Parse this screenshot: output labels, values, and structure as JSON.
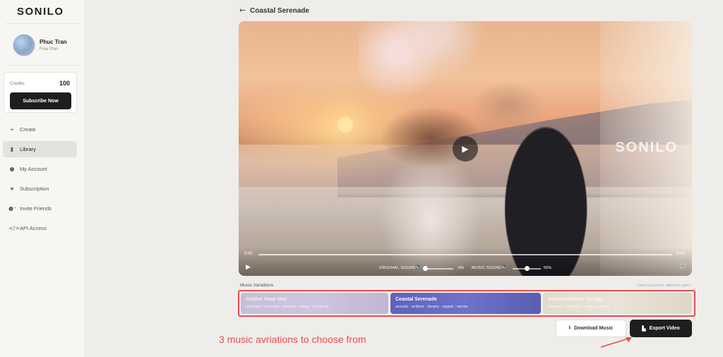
{
  "brand": {
    "logo": "SONILO"
  },
  "profile": {
    "name": "Phuc Tran",
    "plan": "Free Plan"
  },
  "credits": {
    "label": "Credits",
    "value": "100",
    "subscribe_label": "Subscribe Now"
  },
  "nav": [
    {
      "label": "Create",
      "icon": "plus-icon",
      "active": false
    },
    {
      "label": "Library",
      "icon": "book-icon",
      "active": true
    },
    {
      "label": "My Account",
      "icon": "user-icon",
      "active": false
    },
    {
      "label": "Subscription",
      "icon": "star-icon",
      "active": false
    },
    {
      "label": "Invite Friends",
      "icon": "user-plus-icon",
      "active": false
    },
    {
      "label": "API Access",
      "icon": "code-icon",
      "active": false
    }
  ],
  "page": {
    "title": "Coastal Serenade"
  },
  "video": {
    "watermark": "SONILO",
    "current_time": "0:00",
    "duration": "0:00",
    "progress": 0,
    "original_sound_label": "ORIGINAL SOUND",
    "original_sound_pct": "0%",
    "original_sound_level": 0,
    "music_sound_label": "MUSIC SOUND",
    "music_sound_pct": "50%",
    "music_sound_level": 0.5
  },
  "variations": {
    "label": "Music Variations",
    "hint": "Click to preview different styles",
    "items": [
      {
        "title": "Golden Hour Vow",
        "tags": "cinematic · orchestral · romantic · strings · emotional",
        "selected": false,
        "color": "#bcaed3"
      },
      {
        "title": "Coastal Serenade",
        "tags": "acoustic · ambient · dreamy · organic · serene",
        "selected": true,
        "color": "#6164bb"
      },
      {
        "title": "Sunset Horizon Strings",
        "tags": "cinematic · orchestral · uplifting · strings",
        "selected": false,
        "color": "#ded6c4"
      }
    ]
  },
  "actions": {
    "download_label": "Download Music",
    "export_label": "Export Video"
  },
  "annotation": {
    "text": "3 music avriations to choose from",
    "color": "#e74c4c"
  }
}
